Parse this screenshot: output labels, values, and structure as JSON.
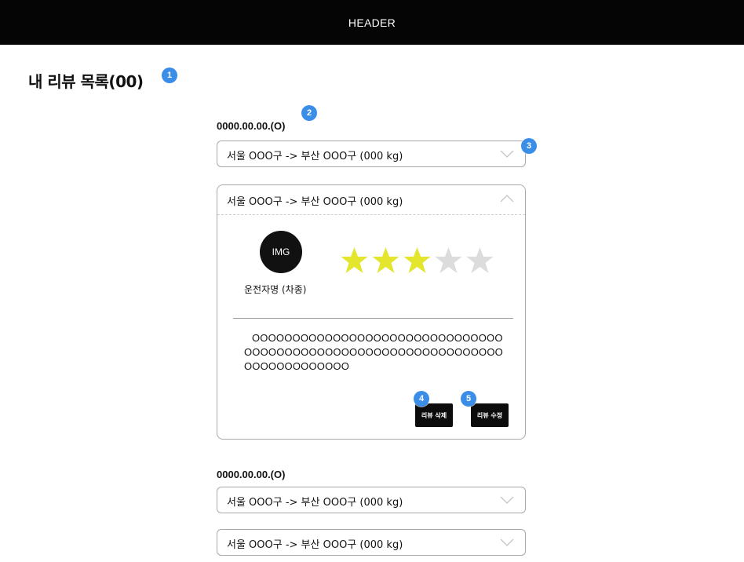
{
  "header": {
    "title": "HEADER"
  },
  "page": {
    "title": "내 리뷰 목록(00)"
  },
  "badges": [
    "1",
    "2",
    "3",
    "4",
    "5"
  ],
  "groups": [
    {
      "date": "0000.00.00.(O)",
      "collapsed_routes": [
        "서울 OOO구 -> 부산 OOO구  (000 kg)"
      ],
      "expanded": {
        "route": "서울 OOO구 -> 부산 OOO구  (000 kg)",
        "avatar_label": "IMG",
        "driver": "운전자명 (차종)",
        "rating": 3,
        "rating_max": 5,
        "review_text": "OOOOOOOOOOOOOOOOOOOOOOOOOOOOOOOOOOOOOOOOOOOOOOOOOOOOOOOOOOOOOOOOOOOOOOOOOOOO",
        "delete_label": "리뷰 삭제",
        "edit_label": "리뷰 수정"
      }
    },
    {
      "date": "0000.00.00.(O)",
      "collapsed_routes": [
        "서울 OOO구 -> 부산 OOO구  (000 kg)",
        "서울 OOO구 -> 부산 OOO구  (000 kg)"
      ]
    }
  ],
  "colors": {
    "header_bg": "#050505",
    "badge": "#3a8ee8",
    "star_filled": "#e3e62c",
    "star_empty": "#dcdcdc",
    "button_bg": "#0c0c0c"
  }
}
